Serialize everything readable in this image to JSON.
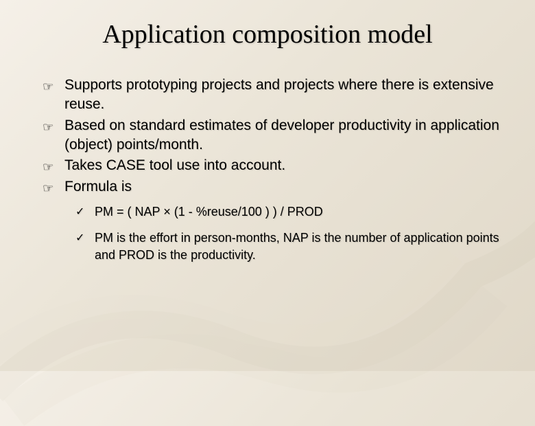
{
  "title": "Application composition model",
  "bullets": [
    "Supports prototyping projects and projects where there is extensive reuse.",
    "Based on standard estimates of developer productivity in application (object) points/month.",
    "Takes CASE tool use into account.",
    "Formula is"
  ],
  "sub_bullets": [
    "PM = ( NAP × (1 - %reuse/100 ) ) / PROD",
    "PM is the effort in person-months, NAP is the number of application points and PROD is the productivity."
  ]
}
